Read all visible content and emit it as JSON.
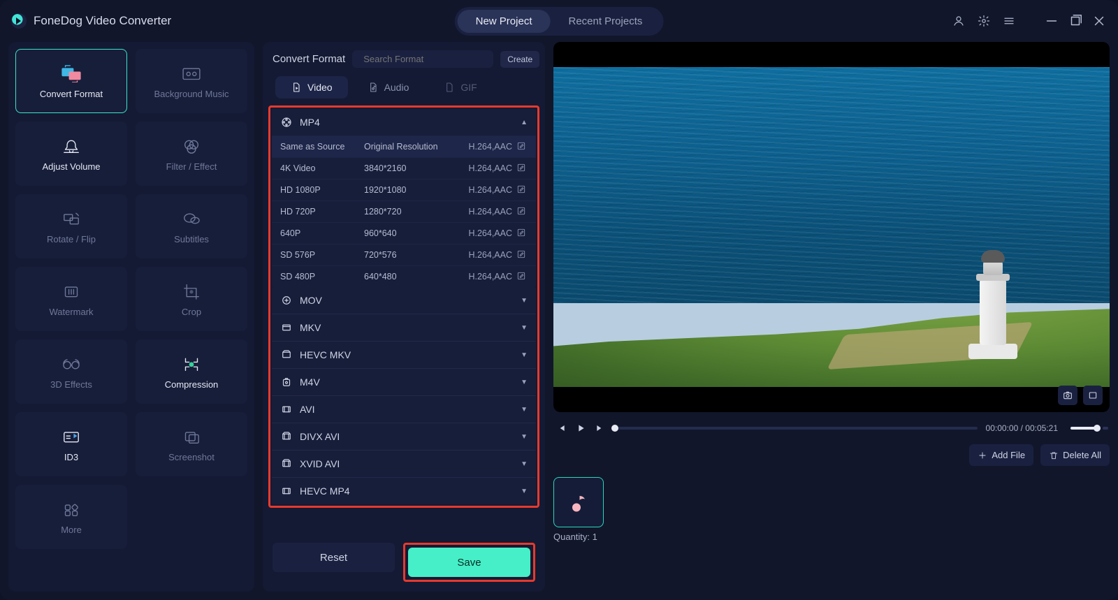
{
  "header": {
    "app_name": "FoneDog Video Converter",
    "tabs": {
      "new": "New Project",
      "recent": "Recent Projects"
    }
  },
  "tools": [
    {
      "id": "convert-format",
      "label": "Convert Format"
    },
    {
      "id": "background-music",
      "label": "Background Music"
    },
    {
      "id": "adjust-volume",
      "label": "Adjust Volume"
    },
    {
      "id": "filter-effect",
      "label": "Filter / Effect"
    },
    {
      "id": "rotate-flip",
      "label": "Rotate / Flip"
    },
    {
      "id": "subtitles",
      "label": "Subtitles"
    },
    {
      "id": "watermark",
      "label": "Watermark"
    },
    {
      "id": "crop",
      "label": "Crop"
    },
    {
      "id": "3d-effects",
      "label": "3D Effects"
    },
    {
      "id": "compression",
      "label": "Compression"
    },
    {
      "id": "id3",
      "label": "ID3"
    },
    {
      "id": "screenshot",
      "label": "Screenshot"
    },
    {
      "id": "more",
      "label": "More"
    }
  ],
  "format_panel": {
    "title": "Convert Format",
    "search_placeholder": "Search Format",
    "create": "Create",
    "tabs": {
      "video": "Video",
      "audio": "Audio",
      "gif": "GIF"
    },
    "mp4": {
      "name": "MP4",
      "rows": [
        {
          "name": "Same as Source",
          "res": "Original Resolution",
          "codec": "H.264,AAC"
        },
        {
          "name": "4K Video",
          "res": "3840*2160",
          "codec": "H.264,AAC"
        },
        {
          "name": "HD 1080P",
          "res": "1920*1080",
          "codec": "H.264,AAC"
        },
        {
          "name": "HD 720P",
          "res": "1280*720",
          "codec": "H.264,AAC"
        },
        {
          "name": "640P",
          "res": "960*640",
          "codec": "H.264,AAC"
        },
        {
          "name": "SD 576P",
          "res": "720*576",
          "codec": "H.264,AAC"
        },
        {
          "name": "SD 480P",
          "res": "640*480",
          "codec": "H.264,AAC"
        }
      ]
    },
    "groups": [
      "MOV",
      "MKV",
      "HEVC MKV",
      "M4V",
      "AVI",
      "DIVX AVI",
      "XVID AVI",
      "HEVC MP4"
    ],
    "reset": "Reset",
    "save": "Save"
  },
  "player": {
    "current": "00:00:00",
    "duration": "00:05:21",
    "sep": " / "
  },
  "files": {
    "add": "Add File",
    "delete_all": "Delete All",
    "quantity_label": "Quantity: ",
    "quantity_value": "1"
  }
}
